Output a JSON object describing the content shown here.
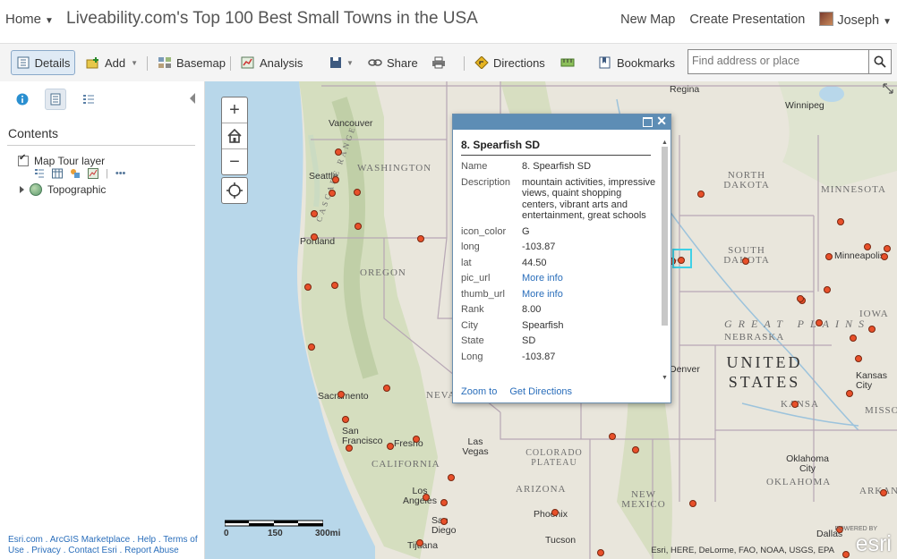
{
  "header": {
    "home_label": "Home",
    "title": "Liveability.com's Top 100 Best Small Towns in the USA",
    "new_map": "New Map",
    "create_presentation": "Create Presentation",
    "user": "Joseph"
  },
  "toolbar": {
    "details": "Details",
    "add": "Add",
    "basemap": "Basemap",
    "analysis": "Analysis",
    "share": "Share",
    "directions": "Directions",
    "bookmarks": "Bookmarks",
    "search_placeholder": "Find address or place"
  },
  "panel": {
    "heading": "Contents",
    "layers": [
      {
        "label": "Map Tour layer",
        "checked": true
      },
      {
        "label": "Topographic"
      }
    ],
    "more": "•••",
    "footer": [
      "Esri.com",
      "ArcGIS Marketplace",
      "Help",
      "Terms of Use",
      "Privacy",
      "Contact Esri",
      "Report Abuse"
    ]
  },
  "map": {
    "state_labels": [
      "WASHINGTON",
      "OREGON",
      "NORTH DAKOTA",
      "MINNESOTA",
      "SOUTH DAKOTA",
      "NEBRASKA",
      "IOWA",
      "KANSA",
      "MISSO",
      "CALIFORNIA",
      "NEVA",
      "ARIZONA",
      "NEW MEXICO",
      "OKLAHOMA",
      "ARKAN"
    ],
    "region_labels": [
      "GREAT PLAINS",
      "COLORADO PLATEAU",
      "CASCADE RANGE"
    ],
    "country_label": "UNITED STATES",
    "city_labels": [
      "Regina",
      "Winnipeg",
      "Vancouver",
      "Seattle",
      "Portland",
      "Minneapolis",
      "Sacramento",
      "San Francisco",
      "Fresno",
      "Las Vegas",
      "Los Angeles",
      "San Diego",
      "Tijuana",
      "Phoenix",
      "Tucson",
      "Denver",
      "Kansas City",
      "Oklahoma City",
      "Dallas"
    ],
    "scale": {
      "labels": [
        "0",
        "150",
        "300mi"
      ]
    },
    "attribution": "Esri, HERE, DeLorme, FAO, NOAA, USGS, EPA",
    "logo": "esri",
    "logo_caption": "POWERED BY"
  },
  "popup": {
    "title": "8. Spearfish SD",
    "fields": [
      {
        "key": "Name",
        "value": "8. Spearfish SD"
      },
      {
        "key": "Description",
        "value": "mountain activities, impressive views, quaint shopping centers, vibrant arts and entertainment, great schools"
      },
      {
        "key": "icon_color",
        "value": "G"
      },
      {
        "key": "long",
        "value": "-103.87"
      },
      {
        "key": "lat",
        "value": "44.50"
      },
      {
        "key": "pic_url",
        "value": "More info",
        "link": true
      },
      {
        "key": "thumb_url",
        "value": "More info",
        "link": true
      },
      {
        "key": "Rank",
        "value": "8.00"
      },
      {
        "key": "City",
        "value": "Spearfish"
      },
      {
        "key": "State",
        "value": "SD"
      },
      {
        "key": "Long",
        "value": "-103.87"
      }
    ],
    "zoom_to": "Zoom to",
    "get_directions": "Get Directions"
  },
  "colors": {
    "accent": "#5d8db5",
    "marker": "#e8502a",
    "selection": "#3fd0e6",
    "link": "#2a6ebb"
  }
}
